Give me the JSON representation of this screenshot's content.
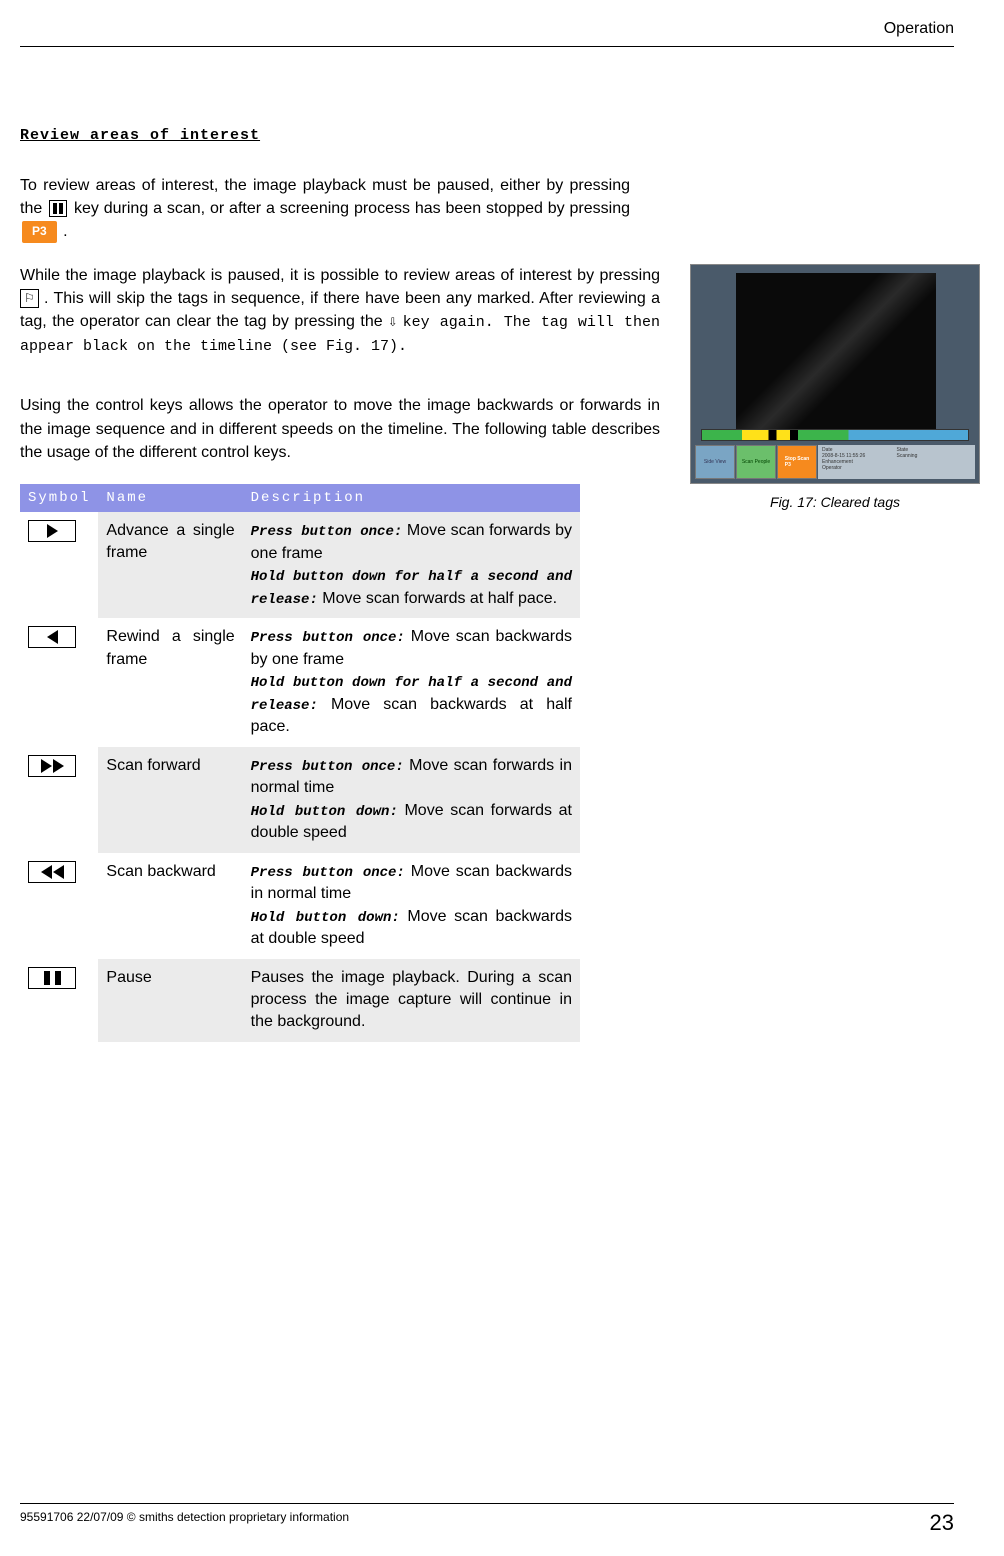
{
  "header": {
    "section": "Operation"
  },
  "title": "Review areas of interest",
  "para1a": "To review areas of interest, the image playback must be paused, either by pressing the ",
  "para1b": " key during a scan, or after a screening process has been stopped by pressing ",
  "para1c": ".",
  "p3_label": "P3",
  "para2a": "While the image playback is paused, it is possible to review areas of interest by pressing ",
  "para2b": ". This will skip the tags in sequence, if there have been any marked. After reviewing a tag, the operator can clear the tag by pressing the ",
  "para2c": "key again. The tag will then appear black on the timeline (see Fig. 17).",
  "down_arrow": "⇩",
  "para3": "Using the control keys allows the operator to move the image backwards or forwards in the image sequence and in different speeds on the timeline. The following table describes the usage of the different control keys.",
  "table": {
    "headers": {
      "symbol": "Symbol",
      "name": "Name",
      "desc": "Description"
    },
    "rows": [
      {
        "name": "Advance a single frame",
        "d1": "Press button once:",
        "d1t": " Move scan forwards by one frame",
        "d2": "Hold button down for half a second and release:",
        "d2t": " Move scan forwards at half pace."
      },
      {
        "name": "Rewind a single frame",
        "d1": "Press button once:",
        "d1t": " Move scan backwards by one frame",
        "d2": "Hold button down for half a second and release:",
        "d2t": " Move scan backwards at half pace."
      },
      {
        "name": "Scan forward",
        "d1": "Press button once:",
        "d1t": " Move scan forwards in normal time",
        "d2": "Hold button down:",
        "d2t": " Move scan forwards at double speed"
      },
      {
        "name": "Scan backward",
        "d1": "Press button once:",
        "d1t": " Move scan backwards in normal time",
        "d2": "Hold button down:",
        "d2t": " Move scan backwards at double speed"
      },
      {
        "name": "Pause",
        "d1": "",
        "d1t": "Pauses the image playback. During a scan process the image capture will continue in the background.",
        "d2": "",
        "d2t": ""
      }
    ]
  },
  "figure": {
    "caption": "Fig. 17: Cleared tags",
    "btn1": "Side View",
    "btn2": "Scan People",
    "btn3": "Stop Scan",
    "btn3_key": "P3",
    "date_label": "Date",
    "date_val": "2008-8-15 11:55:26",
    "state_label": "State",
    "state_val": "Scanning",
    "enh_label": "Enhancement",
    "op_label": "Operator"
  },
  "footer": {
    "left": "95591706 22/07/09 © smiths detection proprietary information",
    "page": "23"
  }
}
